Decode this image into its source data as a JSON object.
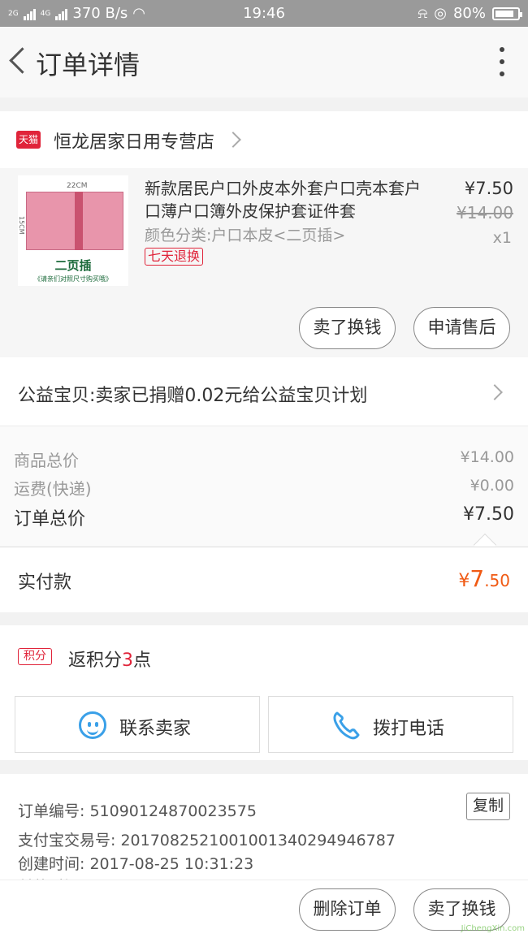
{
  "status_bar": {
    "net1": "2G",
    "net2": "4G",
    "speed": "370 B/s",
    "time": "19:46",
    "battery": "80%"
  },
  "header": {
    "title": "订单详情"
  },
  "shop": {
    "badge": "天猫",
    "name": "恒龙居家日用专营店"
  },
  "product": {
    "title": "新款居民户口外皮本外套户口壳本套户口薄户口簿外皮保护套证件套",
    "spec": "颜色分类:户口本皮<二页插>",
    "return_badge": "七天退换",
    "price": "¥7.50",
    "original_price": "¥14.00",
    "quantity": "x1",
    "image": {
      "dim_width": "22CM",
      "dim_height": "15CM",
      "caption": "二页插",
      "subcaption": "《请亲们对照尺寸购买哦》"
    },
    "buttons": {
      "sell": "卖了换钱",
      "after_sale": "申请售后"
    }
  },
  "charity": {
    "text": "公益宝贝:卖家已捐赠0.02元给公益宝贝计划"
  },
  "summary": {
    "goods_label": "商品总价",
    "goods_value": "¥14.00",
    "shipping_label": "运费(快递)",
    "shipping_value": "¥0.00",
    "total_label": "订单总价",
    "total_value": "¥7.50"
  },
  "payment": {
    "label": "实付款",
    "currency": "¥",
    "integer": "7",
    "decimal": ".50"
  },
  "points": {
    "badge": "积分",
    "prefix": "返积分",
    "count": "3",
    "suffix": "点"
  },
  "contact": {
    "seller": "联系卖家",
    "call": "拨打电话"
  },
  "order_info": {
    "order_no": "订单编号: 51090124870023575",
    "copy": "复制",
    "alipay_no": "支付宝交易号: 2017082521001001340294946787",
    "created": "创建时间: 2017-08-25 10:31:23",
    "paid_partial": "付款时间"
  },
  "bottom": {
    "delete": "删除订单",
    "sell": "卖了换钱"
  },
  "watermark": "JiChengXin.com",
  "colors": {
    "accent": "#e0243a",
    "paid": "#f05a14",
    "icon_blue": "#3aa0e8"
  }
}
